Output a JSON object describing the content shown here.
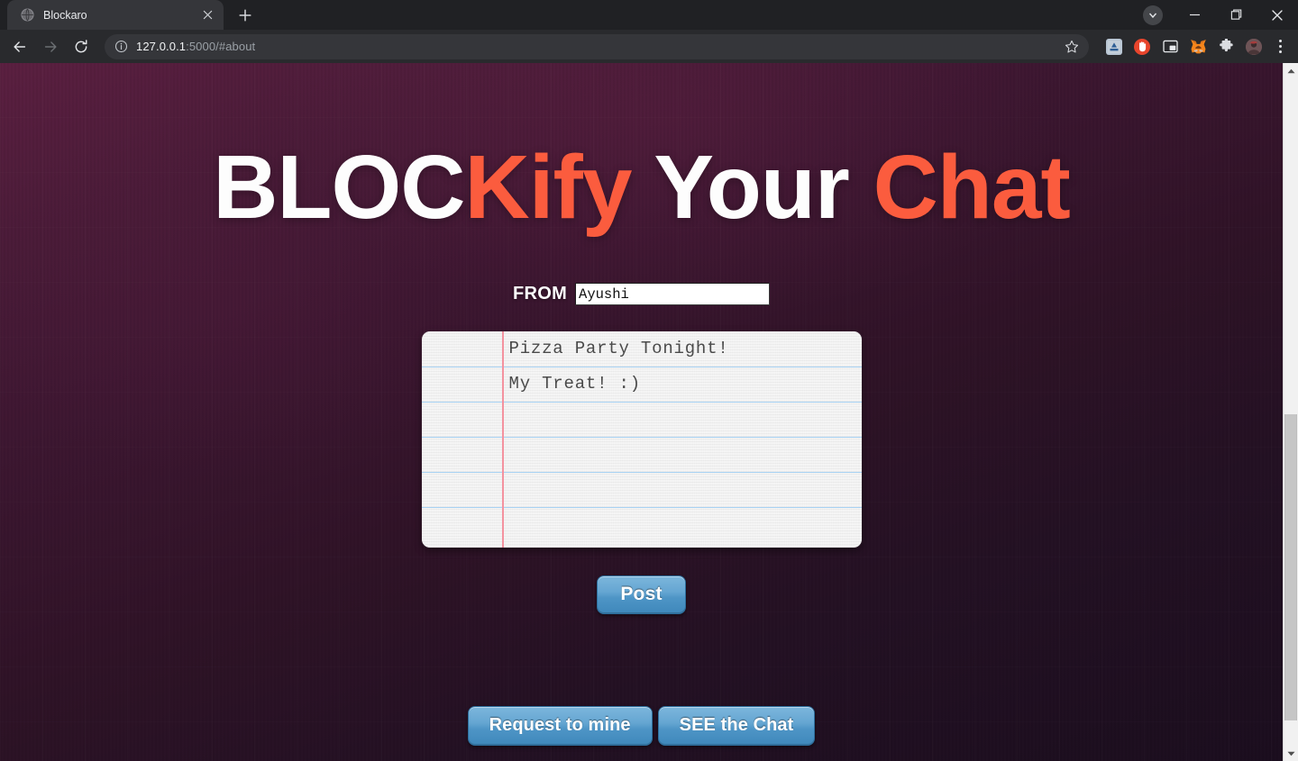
{
  "browser": {
    "tab": {
      "title": "Blockaro",
      "favicon_icon": "globe-icon",
      "close_icon": "close-icon"
    },
    "new_tab_icon": "plus-icon",
    "window_controls": {
      "profile_icon": "caret-down-circle-icon",
      "minimize_icon": "minimize-icon",
      "maximize_icon": "maximize-icon",
      "close_icon": "close-icon"
    },
    "nav": {
      "back_icon": "arrow-left-icon",
      "forward_icon": "arrow-right-icon",
      "reload_icon": "reload-icon"
    },
    "omnibox": {
      "info_icon": "info-circle-icon",
      "url_host": "127.0.0.1",
      "url_rest": ":5000/#about",
      "bookmark_icon": "star-icon"
    },
    "extensions": [
      {
        "name": "app-extension-icon",
        "color": "#6d8fb5",
        "glyph": "A"
      },
      {
        "name": "blocker-extension-icon",
        "color": "#e8452c",
        "glyph": "✋"
      },
      {
        "name": "picture-in-picture-icon",
        "color": "#e8eaed",
        "glyph": ""
      },
      {
        "name": "metamask-fox-icon",
        "color": "#e2761b",
        "glyph": ""
      },
      {
        "name": "extensions-puzzle-icon",
        "color": "#dadce0",
        "glyph": ""
      },
      {
        "name": "profile-avatar-icon",
        "color": "#8a6a6a",
        "glyph": ""
      }
    ],
    "menu_icon": "three-dot-menu-icon"
  },
  "page": {
    "hero": {
      "part1": "BLOC",
      "part2": "Kify",
      "part3": " Your ",
      "part4": "Chat",
      "accent_color": "#fb5c3e",
      "base_color": "#fdfdfd"
    },
    "from": {
      "label": "FROM",
      "value": "Ayushi",
      "placeholder": ""
    },
    "notepad": {
      "lines": [
        "Pizza Party Tonight!",
        "My Treat! :)",
        "",
        "",
        ""
      ],
      "rule_color": "#9ecdf2",
      "margin_color": "#f4929f",
      "paper_color": "#f1f1f1"
    },
    "post_button": "Post",
    "footer_buttons": [
      "Request to mine",
      "SEE the Chat"
    ],
    "button_color": "#4e95c6"
  },
  "scrollbar": {
    "up_arrow_icon": "caret-up-icon",
    "down_arrow_icon": "caret-down-icon"
  }
}
